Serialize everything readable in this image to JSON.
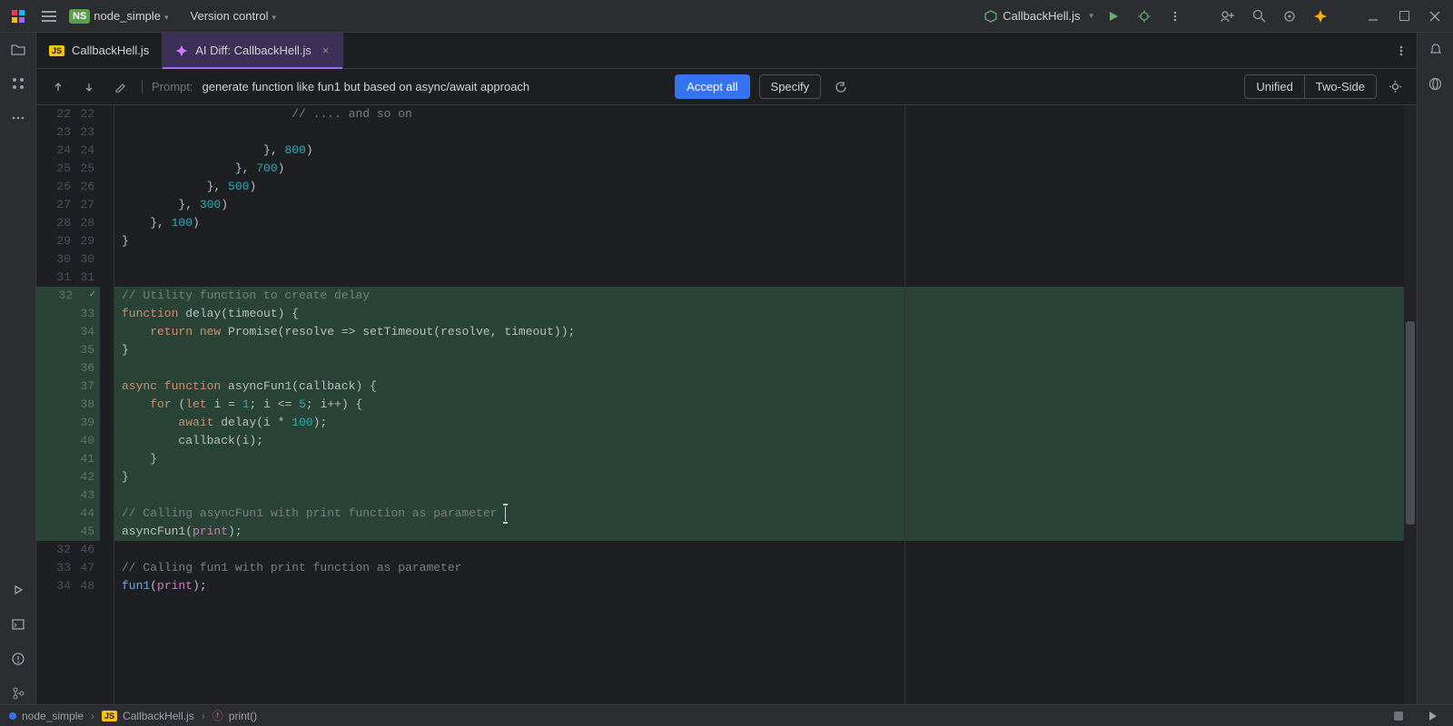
{
  "titlebar": {
    "project_badge": "NS",
    "project_name": "node_simple",
    "vcs_label": "Version control",
    "run_config": "CallbackHell.js"
  },
  "tabs": [
    {
      "label": "CallbackHell.js",
      "kind": "js",
      "active": false
    },
    {
      "label": "AI Diff: CallbackHell.js",
      "kind": "ai",
      "active": true
    }
  ],
  "actionbar": {
    "prompt_label": "Prompt:",
    "prompt_text": "generate function like fun1 but based on async/await approach",
    "accept_label": "Accept all",
    "specify_label": "Specify",
    "view_unified": "Unified",
    "view_twoside": "Two-Side"
  },
  "status": {
    "crumbs": [
      "node_simple",
      "CallbackHell.js",
      "print()"
    ]
  },
  "chart_data": {
    "type": "table",
    "description": "Rows of a side-by-side line-numbered AI diff. lnL/lnR = left/right line numbers (empty means none shown). added=true rows are highlighted green (new code).",
    "rows": [
      {
        "lnL": "22",
        "lnR": "22",
        "added": false,
        "tokens": [
          [
            "",
            "                        "
          ],
          [
            "cmt",
            "// .... and so on"
          ]
        ]
      },
      {
        "lnL": "23",
        "lnR": "23",
        "added": false,
        "tokens": []
      },
      {
        "lnL": "24",
        "lnR": "24",
        "added": false,
        "tokens": [
          [
            "",
            "                    }, "
          ],
          [
            "numc",
            "800"
          ],
          [
            "",
            ")"
          ]
        ]
      },
      {
        "lnL": "25",
        "lnR": "25",
        "added": false,
        "tokens": [
          [
            "",
            "                }, "
          ],
          [
            "numc",
            "700"
          ],
          [
            "",
            ")"
          ]
        ]
      },
      {
        "lnL": "26",
        "lnR": "26",
        "added": false,
        "tokens": [
          [
            "",
            "            }, "
          ],
          [
            "numc",
            "500"
          ],
          [
            "",
            ")"
          ]
        ]
      },
      {
        "lnL": "27",
        "lnR": "27",
        "added": false,
        "tokens": [
          [
            "",
            "        }, "
          ],
          [
            "numc",
            "300"
          ],
          [
            "",
            ")"
          ]
        ]
      },
      {
        "lnL": "28",
        "lnR": "28",
        "added": false,
        "tokens": [
          [
            "",
            "    }, "
          ],
          [
            "numc",
            "100"
          ],
          [
            "",
            ")"
          ]
        ]
      },
      {
        "lnL": "29",
        "lnR": "29",
        "added": false,
        "tokens": [
          [
            "",
            "}"
          ]
        ]
      },
      {
        "lnL": "30",
        "lnR": "30",
        "added": false,
        "tokens": []
      },
      {
        "lnL": "31",
        "lnR": "31",
        "added": false,
        "tokens": []
      },
      {
        "lnL": "",
        "lnR": "32",
        "added": true,
        "mark": "✓",
        "tokens": [
          [
            "cmt",
            "// Utility function to create delay"
          ]
        ]
      },
      {
        "lnL": "",
        "lnR": "33",
        "added": true,
        "tokens": [
          [
            "kw",
            "function "
          ],
          [
            "fn",
            "delay"
          ],
          [
            "",
            "(timeout) {"
          ]
        ]
      },
      {
        "lnL": "",
        "lnR": "34",
        "added": true,
        "tokens": [
          [
            "",
            "    "
          ],
          [
            "kw",
            "return new "
          ],
          [
            "fn",
            "Promise"
          ],
          [
            "",
            "(resolve => setTimeout(resolve, timeout));"
          ]
        ]
      },
      {
        "lnL": "",
        "lnR": "35",
        "added": true,
        "tokens": [
          [
            "",
            "}"
          ]
        ]
      },
      {
        "lnL": "",
        "lnR": "36",
        "added": true,
        "tokens": []
      },
      {
        "lnL": "",
        "lnR": "37",
        "added": true,
        "tokens": [
          [
            "kw",
            "async function "
          ],
          [
            "fn",
            "asyncFun1"
          ],
          [
            "",
            "(callback) {"
          ]
        ]
      },
      {
        "lnL": "",
        "lnR": "38",
        "added": true,
        "tokens": [
          [
            "",
            "    "
          ],
          [
            "kw",
            "for "
          ],
          [
            "",
            "("
          ],
          [
            "kw",
            "let "
          ],
          [
            "",
            "i = "
          ],
          [
            "numc",
            "1"
          ],
          [
            "",
            "; i <= "
          ],
          [
            "numc",
            "5"
          ],
          [
            "",
            "; i++) {"
          ]
        ]
      },
      {
        "lnL": "",
        "lnR": "39",
        "added": true,
        "tokens": [
          [
            "",
            "        "
          ],
          [
            "kw",
            "await "
          ],
          [
            "fn",
            "delay"
          ],
          [
            "",
            "(i * "
          ],
          [
            "numc",
            "100"
          ],
          [
            "",
            ");"
          ]
        ]
      },
      {
        "lnL": "",
        "lnR": "40",
        "added": true,
        "tokens": [
          [
            "",
            "        callback(i);"
          ]
        ]
      },
      {
        "lnL": "",
        "lnR": "41",
        "added": true,
        "tokens": [
          [
            "",
            "    }"
          ]
        ]
      },
      {
        "lnL": "",
        "lnR": "42",
        "added": true,
        "tokens": [
          [
            "",
            "}"
          ]
        ]
      },
      {
        "lnL": "",
        "lnR": "43",
        "added": true,
        "tokens": []
      },
      {
        "lnL": "",
        "lnR": "44",
        "added": true,
        "tokens": [
          [
            "cmt",
            "// Calling asyncFun1 with print function as parameter"
          ]
        ]
      },
      {
        "lnL": "",
        "lnR": "45",
        "added": true,
        "tokens": [
          [
            "fn",
            "asyncFun1"
          ],
          [
            "",
            "("
          ],
          [
            "pl",
            "print"
          ],
          [
            "",
            ");"
          ]
        ]
      },
      {
        "lnL": "32",
        "lnR": "46",
        "added": false,
        "tokens": []
      },
      {
        "lnL": "33",
        "lnR": "47",
        "added": false,
        "tokens": [
          [
            "cmt",
            "// Calling fun1 with print function as parameter"
          ]
        ]
      },
      {
        "lnL": "34",
        "lnR": "48",
        "added": false,
        "tokens": [
          [
            "call",
            "fun1"
          ],
          [
            "",
            "("
          ],
          [
            "pl",
            "print"
          ],
          [
            "",
            ");"
          ]
        ]
      }
    ]
  }
}
